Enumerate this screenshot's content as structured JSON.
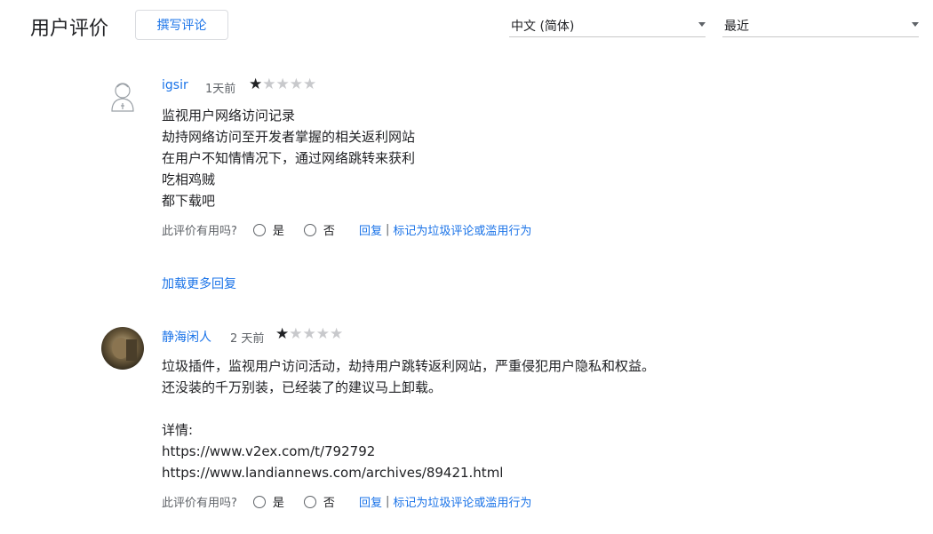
{
  "header": {
    "title": "用户评价",
    "write_review_label": "撰写评论",
    "language_select": "中文 (简体)",
    "sort_select": "最近"
  },
  "reviews": [
    {
      "author": "igsir",
      "date": "1天前",
      "rating": 1,
      "lines": [
        "监视用户网络访问记录",
        "劫持网络访问至开发者掌握的相关返利网站",
        "在用户不知情情况下，通过网络跳转来获利",
        "吃相鸡贼",
        "都下载吧"
      ],
      "helpful_prompt": "此评价有用吗?",
      "yes_label": "是",
      "no_label": "否",
      "reply_label": "回复",
      "report_label": "标记为垃圾评论或滥用行为",
      "load_more": "加载更多回复"
    },
    {
      "author": "静海闲人",
      "date": "2 天前",
      "rating": 1,
      "lines": [
        "垃圾插件，监视用户访问活动，劫持用户跳转返利网站，严重侵犯用户隐私和权益。",
        "还没装的千万别装，已经装了的建议马上卸载。",
        "",
        "详情:",
        "https://www.v2ex.com/t/792792",
        "https://www.landiannews.com/archives/89421.html"
      ],
      "helpful_prompt": "此评价有用吗?",
      "yes_label": "是",
      "no_label": "否",
      "reply_label": "回复",
      "report_label": "标记为垃圾评论或滥用行为"
    }
  ]
}
